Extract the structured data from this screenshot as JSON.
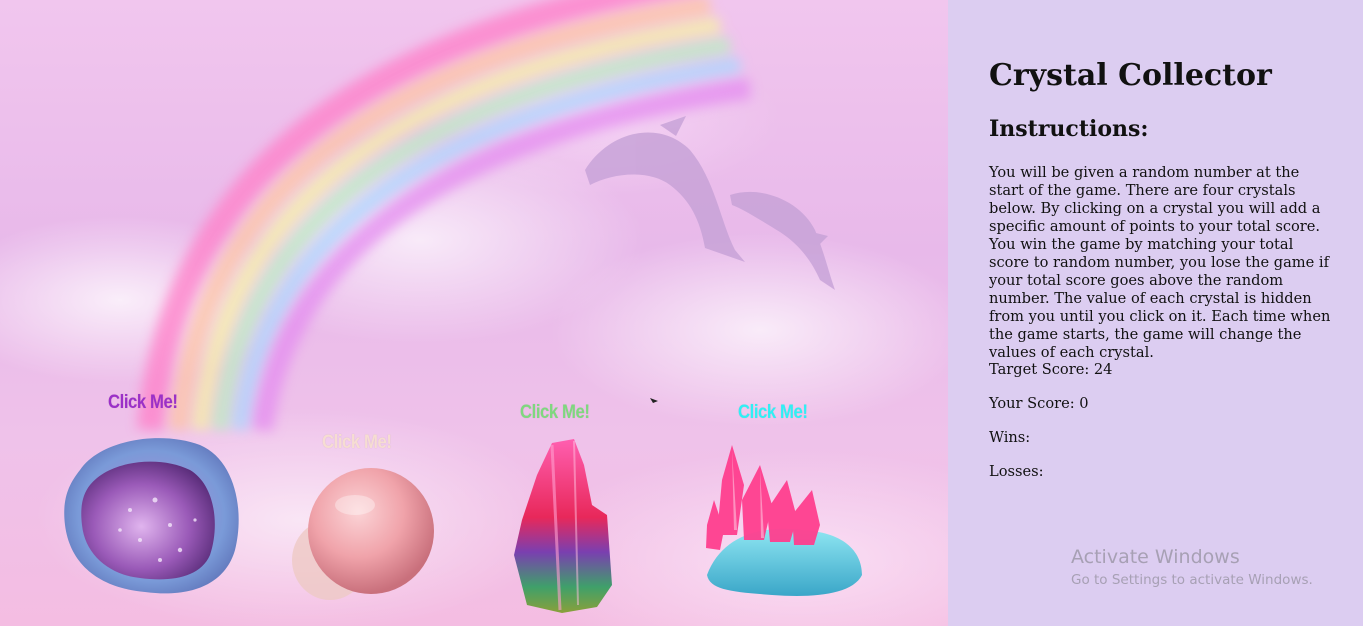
{
  "game": {
    "crystals": [
      {
        "label": "Click Me!",
        "label_color": "#9b30c8",
        "icon": "geode-crystal-icon"
      },
      {
        "label": "Click Me!",
        "label_color": "#f6ddd2",
        "icon": "rose-quartz-sphere-icon"
      },
      {
        "label": "Click Me!",
        "label_color": "#7fd87f",
        "icon": "tourmaline-crystal-icon"
      },
      {
        "label": "Click Me!",
        "label_color": "#2ff0f5",
        "icon": "pink-aqua-cluster-icon"
      }
    ]
  },
  "panel": {
    "title": "Crystal Collector",
    "subtitle": "Instructions:",
    "instructions": "You will be given a random number at the start of the game. There are four crystals below. By clicking on a crystal you will add a specific amount of points to your total score. You win the game by matching your total score to random number, you lose the game if your total score goes above the random number. The value of each crystal is hidden from you until you click on it. Each time when the game starts, the game will change the values of each crystal.",
    "target_score": "Target Score: 24",
    "your_score": "Your Score: 0",
    "wins": "Wins:",
    "losses": "Losses:"
  },
  "watermark": {
    "title": "Activate Windows",
    "subtitle": "Go to Settings to activate Windows."
  }
}
